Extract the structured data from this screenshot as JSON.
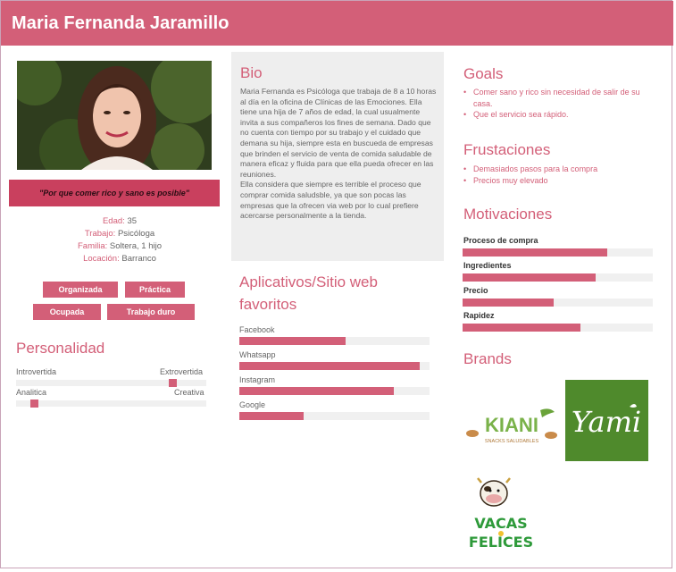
{
  "persona": {
    "name": "Maria Fernanda Jaramillo",
    "quote": "\"Por que comer rico y sano es posible\"",
    "facts": [
      {
        "key": "Edad:",
        "value": "35"
      },
      {
        "key": "Trabajo:",
        "value": "Psicóloga"
      },
      {
        "key": "Familia:",
        "value": "Soltera, 1 hijo"
      },
      {
        "key": "Locación:",
        "value": "Barranco"
      }
    ],
    "tags": [
      "Organizada",
      "Práctica",
      "Ocupada",
      "Trabajo duro"
    ]
  },
  "personality": {
    "title": "Personalidad",
    "scales": [
      {
        "left": "Introvertida",
        "right": "Extrovertida",
        "level": 0.84
      },
      {
        "left": "Analitica",
        "right": "Creativa",
        "level": 0.08
      }
    ]
  },
  "bio": {
    "title": "Bio",
    "text": "Maria Fernanda es Psicóloga que trabaja de 8 a 10 horas al día en la oficina de Clínicas de las Emociones. Ella tiene una hija de 7 años de edad, la cual usualmente invita a sus compañeros los fines de semana. Dado que no cuenta con tiempo por su trabajo y el cuidado que demana su hija, siempre esta en buscueda de empresas que brinden el servicio de venta de comida saludable de manera eficaz y fluida para que ella pueda ofrecer en las reuniones.\nElla considera que siempre es terrible el proceso que comprar comida saludsble, ya que son pocas las empresas que la ofrecen via web por lo cual prefiere acercarse personalmente a la tienda."
  },
  "apps": {
    "title": "Aplicativos/Sitio web favoritos",
    "items": [
      {
        "label": "Facebook",
        "level": 0.56
      },
      {
        "label": "Whatsapp",
        "level": 0.95
      },
      {
        "label": "Instagram",
        "level": 0.81
      },
      {
        "label": "Google",
        "level": 0.34
      }
    ]
  },
  "goals": {
    "title": "Goals",
    "items": [
      "Comer sano y rico sin necesidad de salir de su casa.",
      "Que el servicio sea rápido."
    ]
  },
  "frustrations": {
    "title": "Frustaciones",
    "items": [
      "Demasiados pasos para la compra",
      "Precios muy elevado"
    ]
  },
  "motivations": {
    "title": "Motivaciones",
    "items": [
      {
        "label": "Proceso de compra",
        "level": 0.76
      },
      {
        "label": "Ingredientes",
        "level": 0.7
      },
      {
        "label": "Precio",
        "level": 0.48
      },
      {
        "label": "Rapidez",
        "level": 0.62
      }
    ]
  },
  "brands": {
    "title": "Brands",
    "logos": [
      {
        "name": "KIANI",
        "tagline": "SNACKS SALUDABLES"
      },
      {
        "name": "Yami"
      },
      {
        "name": "VACAS FELICES"
      }
    ]
  },
  "colors": {
    "accent": "#d35f78",
    "quote_bg": "#c9405e",
    "yami_green": "#4f8a2c"
  }
}
